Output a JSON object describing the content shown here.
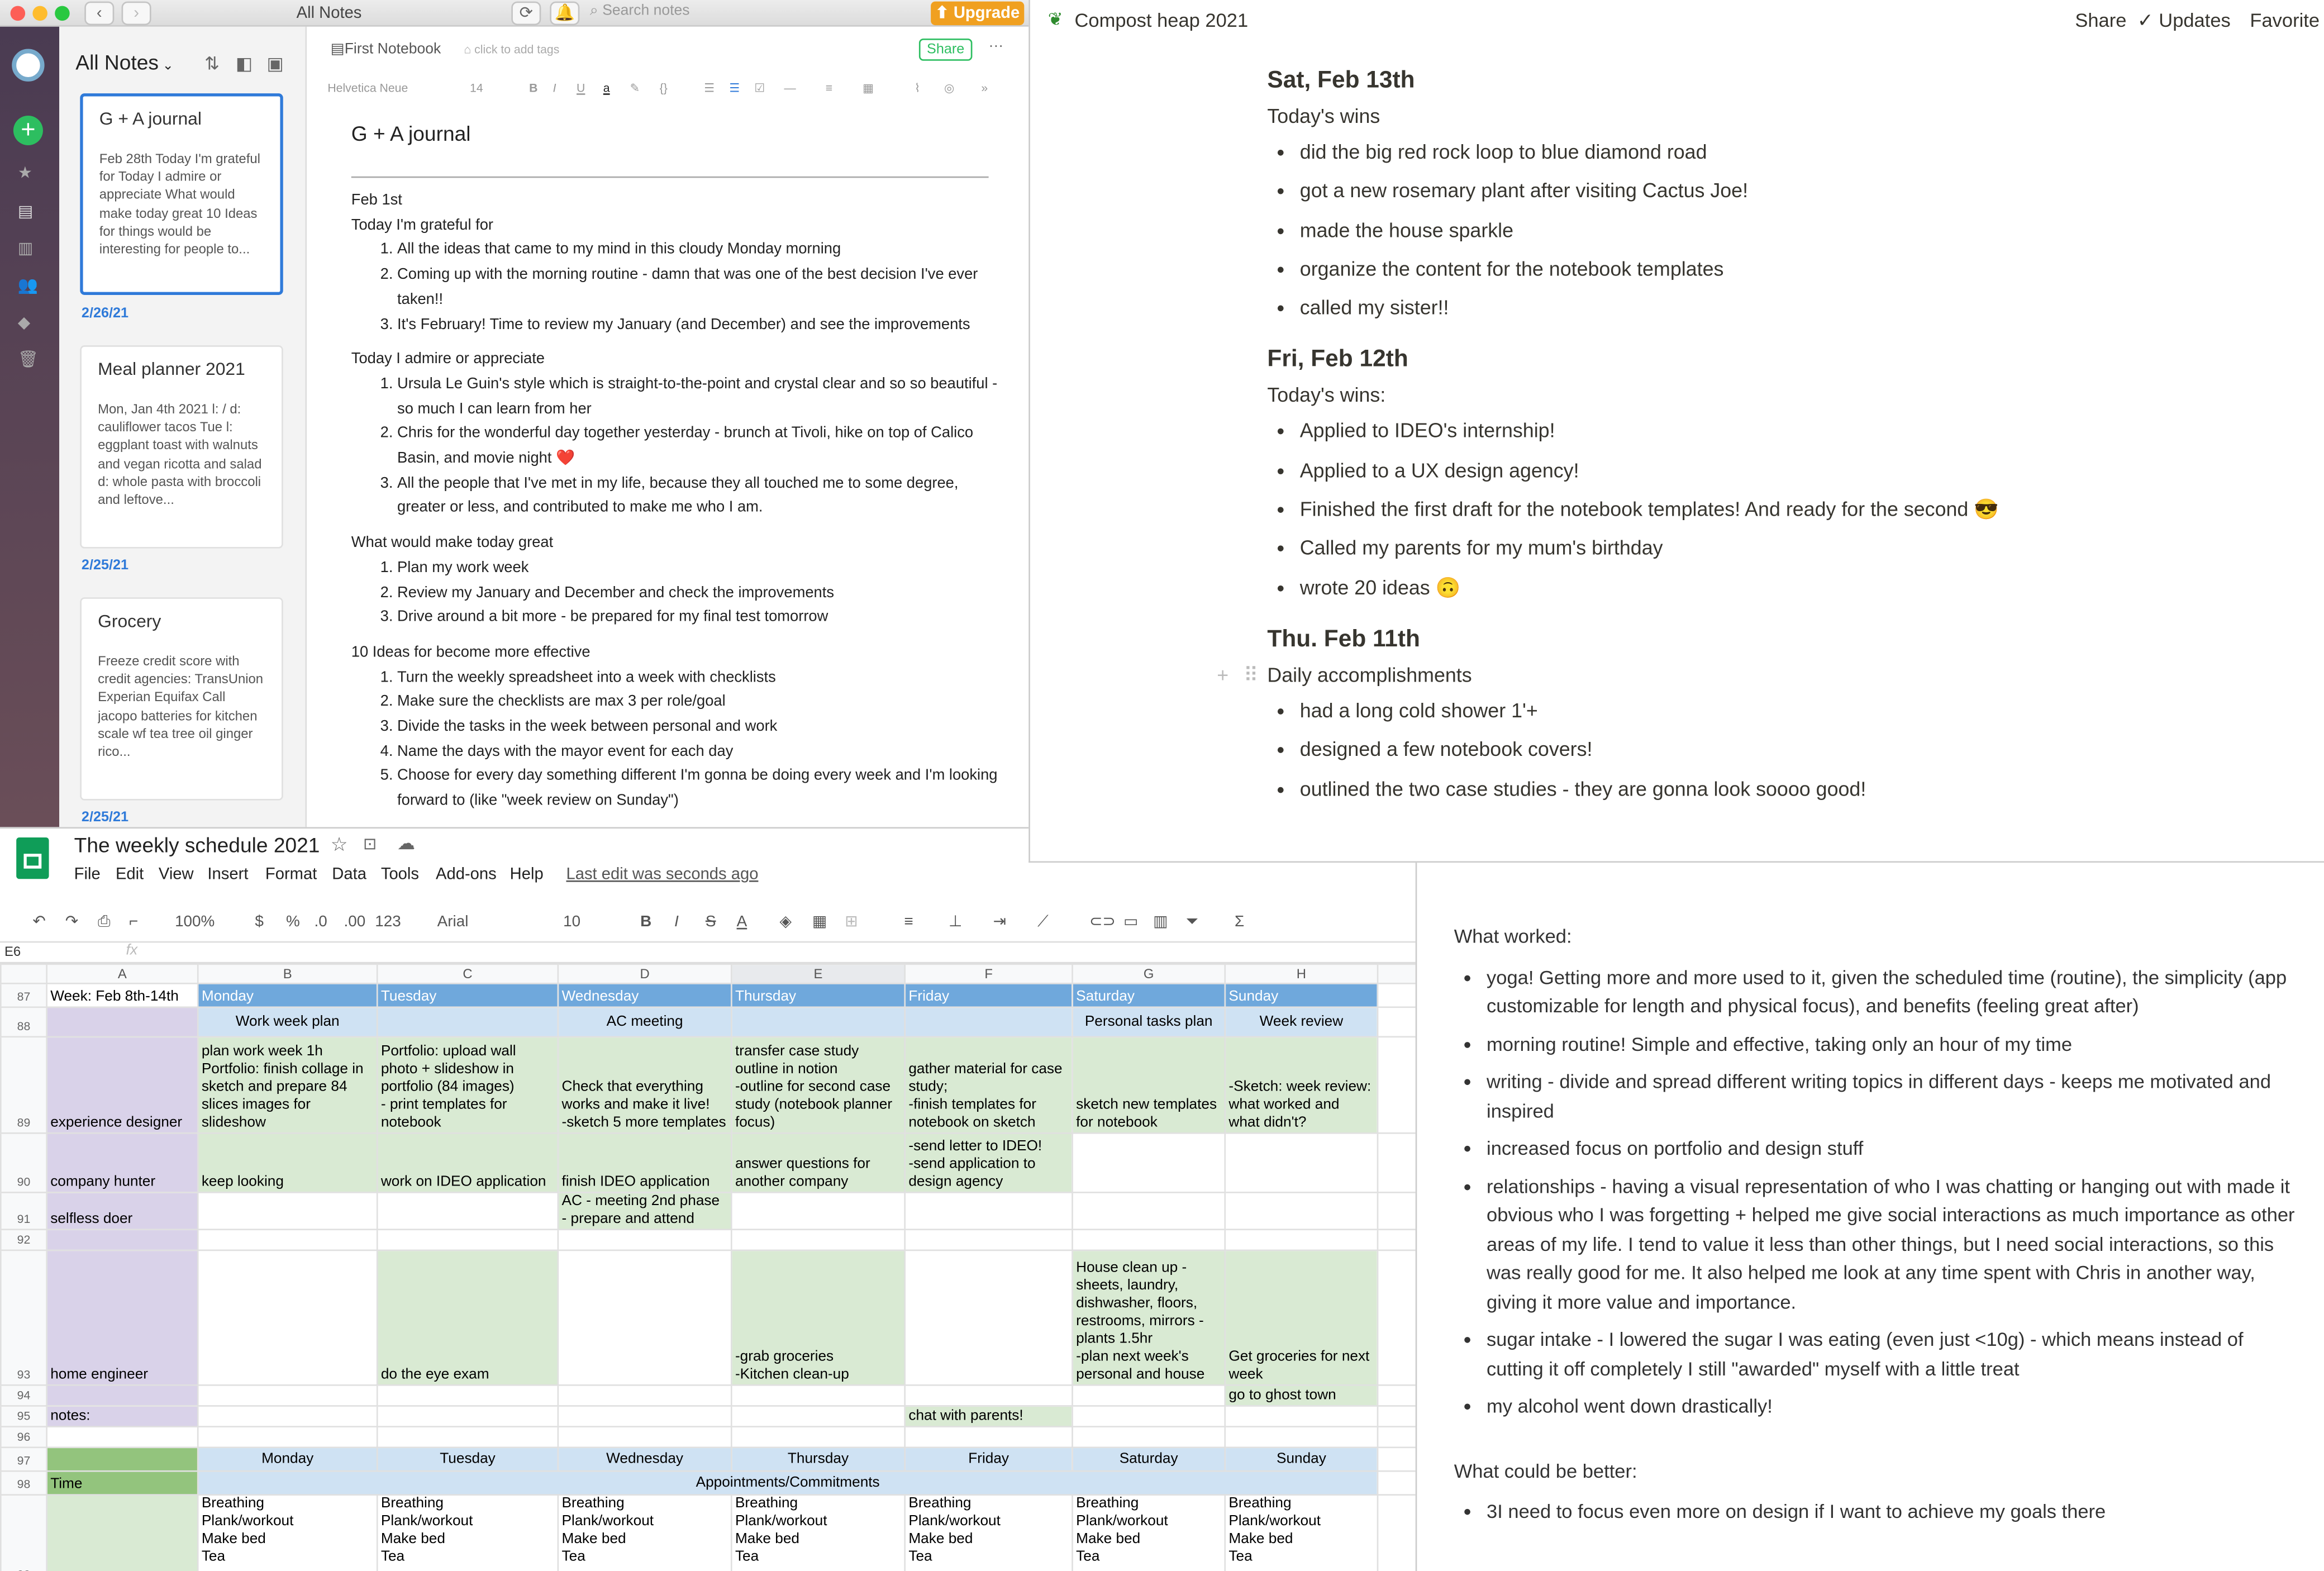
{
  "evernote": {
    "window_title": "All Notes",
    "search_placeholder": "Search notes",
    "upgrade": "Upgrade",
    "list_title": "All Notes",
    "notes": [
      {
        "title": "G + A journal",
        "snippet": "Feb 28th Today I'm grateful for Today I admire or appreciate What would make today great 10 Ideas for things would be interesting for people to...",
        "date": "2/26/21"
      },
      {
        "title": "Meal planner 2021",
        "snippet": "Mon, Jan 4th 2021 l: / d: cauliflower tacos Tue l: eggplant toast with walnuts and vegan ricotta and salad d: whole pasta with broccoli and leftove...",
        "date": "2/25/21"
      },
      {
        "title": "Grocery",
        "snippet": "Freeze credit score with credit agencies: TransUnion Experian Equifax Call jacopo batteries for kitchen scale wf tea tree oil ginger rico...",
        "date": "2/25/21"
      }
    ],
    "notebook": "First Notebook",
    "tags_placeholder": "click to add tags",
    "share": "Share",
    "more": "···",
    "font": "Helvetica Neue",
    "font_size": "14",
    "note_title": "G + A journal",
    "date_heading": "Feb 1st",
    "sec1": "Today I'm grateful for",
    "grateful": [
      "All the ideas that came to my mind in this cloudy Monday morning",
      "Coming up with the morning routine - damn that was one of the best decision I've ever taken!!",
      "It's February! Time to review my January (and December) and see the improvements"
    ],
    "sec2": "Today I admire or appreciate",
    "admire": [
      "Ursula Le Guin's style which is straight-to-the-point and crystal clear and so so beautiful - so much I can learn from her",
      "Chris for the wonderful day together yesterday - brunch at Tivoli, hike on top of Calico Basin, and movie night ❤️",
      "All the people that I've met in my life, because they all touched me to some degree, greater or less, and contributed to make me who I am."
    ],
    "sec3": "What would make today great",
    "great": [
      "Plan my work week",
      "Review my January and December and check the improvements",
      "Drive around a bit more - be prepared for my final test tomorrow"
    ],
    "sec4": "10 Ideas for become more effective",
    "ideas": [
      "Turn the weekly spreadsheet into a week with checklists",
      "Make sure the checklists are max 3 per role/goal",
      "Divide the tasks in the week between personal and work",
      "Name the days with the mayor event for each day",
      "Choose for every day something different I'm gonna be doing every week and I'm looking forward to (like \"week review on Sunday\")"
    ]
  },
  "notion": {
    "page_title": "Compost heap 2021",
    "share": "Share",
    "updates": "Updates",
    "favorite": "Favorite",
    "d1": "Sat, Feb 13th",
    "d1_sub": "Today's wins",
    "d1_items": [
      "did the big red rock loop to blue diamond road",
      "got a new rosemary plant after visiting Cactus Joe!",
      "made the house sparkle",
      "organize the content for the notebook templates",
      "called my sister!!"
    ],
    "d2": "Fri, Feb 12th",
    "d2_sub": "Today's wins:",
    "d2_items": [
      "Applied to IDEO's internship!",
      "Applied to a UX design agency!",
      "Finished the first draft for the notebook templates! And ready for the second 😎",
      "Called my parents for my mum's birthday",
      "wrote 20 ideas 🙃"
    ],
    "d3": "Thu. Feb 11th",
    "d3_sub": "Daily accomplishments",
    "d3_items": [
      "had a long cold shower 1'+",
      "designed a few notebook covers!",
      "outlined the two case studies - they are gonna look soooo good!"
    ]
  },
  "sheets": {
    "title": "The weekly schedule 2021",
    "menus": [
      "File",
      "Edit",
      "View",
      "Insert",
      "Format",
      "Data",
      "Tools",
      "Add-ons",
      "Help"
    ],
    "last_edit": "Last edit was seconds ago",
    "zoom": "100%",
    "currency": "$",
    "percent": "%",
    "dec1": ".0",
    "dec2": ".00",
    "fmt": "123",
    "font": "Arial",
    "size": "10",
    "cell_ref": "E6",
    "fx": "fx",
    "cols": [
      "A",
      "B",
      "C",
      "D",
      "E",
      "F",
      "G",
      "H"
    ],
    "rows": [
      {
        "n": "87",
        "c": [
          "Week: Feb 8th-14th",
          "Monday",
          "Tuesday",
          "Wednesday",
          "Thursday",
          "Friday",
          "Saturday",
          "Sunday"
        ]
      },
      {
        "n": "88",
        "c": [
          "",
          "Work week plan",
          "",
          "AC meeting",
          "",
          "",
          "Personal tasks plan",
          "Week review"
        ]
      },
      {
        "n": "89",
        "c": [
          "experience designer",
          "plan work week 1h\nPortfolio: finish collage in sketch and prepare 84 slices images for slideshow",
          "Portfolio: upload wall photo + slideshow in portfolio (84 images)\n- print templates for notebook",
          "Check that everything works and make it live!\n-sketch 5 more templates",
          "transfer case study outline in notion\n-outline for second case study (notebook planner focus)",
          "gather material for case study;\n-finish templates for notebook on sketch",
          "sketch new templates for notebook",
          "-Sketch: week review: what worked and what didn't?"
        ]
      },
      {
        "n": "90",
        "c": [
          "company hunter",
          "keep looking",
          "work on IDEO application",
          "finish IDEO application",
          "answer questions for another company",
          "-send letter to IDEO!\n-send application to design agency",
          "",
          ""
        ]
      },
      {
        "n": "91",
        "c": [
          "selfless doer",
          "",
          "",
          "AC - meeting 2nd phase\n- prepare and attend",
          "",
          "",
          "",
          ""
        ]
      },
      {
        "n": "92",
        "c": [
          "",
          "",
          "",
          "",
          "",
          "",
          "",
          ""
        ]
      },
      {
        "n": "93",
        "c": [
          "home engineer",
          "",
          "do the eye exam",
          "",
          "-grab groceries\n-Kitchen clean-up",
          "",
          "House clean up - sheets, laundry, dishwasher, floors, restrooms, mirrors - plants 1.5hr\n-plan next week's personal and house",
          "Get groceries for next week"
        ]
      },
      {
        "n": "94",
        "c": [
          "",
          "",
          "",
          "",
          "",
          "",
          "",
          "go to ghost town"
        ]
      },
      {
        "n": "95",
        "c": [
          "notes:",
          "",
          "",
          "",
          "",
          "chat with parents!",
          "",
          ""
        ]
      },
      {
        "n": "96",
        "c": [
          "",
          "",
          "",
          "",
          "",
          "",
          "",
          ""
        ]
      },
      {
        "n": "97",
        "c": [
          "",
          "Monday",
          "Tuesday",
          "Wednesday",
          "Thursday",
          "Friday",
          "Saturday",
          "Sunday"
        ]
      },
      {
        "n": "98",
        "c": [
          "Time",
          "Appointments/Commitments"
        ]
      },
      {
        "n": "99",
        "c": [
          "",
          "Breathing\nPlank/workout\nMake bed\nTea",
          "Breathing\nPlank/workout\nMake bed\nTea",
          "Breathing\nPlank/workout\nMake bed\nTea",
          "Breathing\nPlank/workout\nMake bed\nTea",
          "Breathing\nPlank/workout\nMake bed\nTea",
          "Breathing\nPlank/workout\nMake bed\nTea",
          "Breathing\nPlank/workout\nMake bed\nTea"
        ]
      }
    ]
  },
  "review": {
    "worked_title": "What worked:",
    "worked": [
      "yoga! Getting more and more used to it, given the scheduled time (routine), the simplicity (app customizable for length and physical focus), and benefits (feeling great after)",
      "morning routine! Simple and effective, taking only an hour of my time",
      "writing - divide and spread different writing topics in different days - keeps me motivated and inspired",
      "increased focus on portfolio and design stuff",
      "relationships - having a visual representation of who I was chatting or hanging out with made it obvious who I was forgetting + helped me give social interactions as much importance as other areas of my life. I tend to value it less than other things, but I need social interactions, so this was really good for me. It also helped me look at any time spent with Chris in another way, giving it more value and importance.",
      "sugar intake - I lowered the sugar I was eating (even just <10g) - which means instead of cutting it off completely I still \"awarded\" myself with a little treat",
      "my alcohol went down drastically!"
    ],
    "better_title": "What could be better:",
    "better": [
      "3I need to focus even more on design if I want to achieve my goals there"
    ]
  },
  "colors": {
    "evernote_green": "#00a82d",
    "upgrade": "#f0a020",
    "sheets_header": "#6fa8dc",
    "sheets_green": "#d9ead3",
    "sheets_purple": "#d9d2e9",
    "sheets_light_blue": "#cfe2f3"
  }
}
